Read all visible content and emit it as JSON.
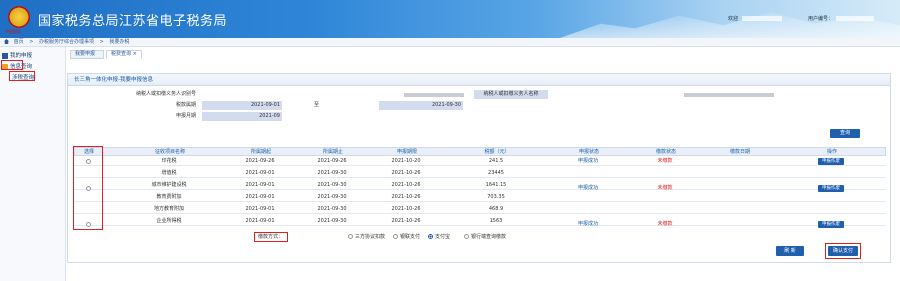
{
  "header": {
    "emblem_sub": "中国税务",
    "title": "国家税务总局江苏省电子税务局",
    "user_prefix": "欢迎",
    "user_mid": "",
    "user_label": "用户编号："
  },
  "breadcrumb": {
    "items": [
      "首页",
      ">",
      "办税服务厅综合办理事项",
      ">",
      "我要办税"
    ]
  },
  "sidebar": {
    "items": [
      {
        "label": "我的申报"
      },
      {
        "label": "信息查询"
      },
      {
        "label": "涉税查询"
      }
    ]
  },
  "tabs": [
    {
      "label": "我要申报"
    },
    {
      "label": "税费查询 ×"
    }
  ],
  "panel": {
    "title": "长三角一体化申报-我要申报信息",
    "taxpayer_id_label": "纳税人或扣缴义务人识别号",
    "taxpayer_name_label": "纳税人或扣缴义务人名称",
    "period_label": "税款属期",
    "period_start": "2021-09-01",
    "period_to": "至",
    "period_end": "2021-09-30",
    "declare_month_label": "申报月期",
    "declare_month": "2021-09",
    "query_button": "查询"
  },
  "table": {
    "headers": [
      "选择",
      "征收项目名称",
      "所属期起",
      "所属期止",
      "申报期限",
      "税额（元）",
      "申报状态",
      "缴款状态",
      "缴款日期",
      "操作"
    ],
    "rows": [
      {
        "name": "印花税",
        "start": "2021-09-26",
        "end": "2021-09-26",
        "deadline": "2021-10-20",
        "amount": "241.5"
      },
      {
        "name": "增值税",
        "start": "2021-09-01",
        "end": "2021-09-30",
        "deadline": "2021-10-26",
        "amount": "23445"
      },
      {
        "name": "城市维护建设税",
        "start": "2021-09-01",
        "end": "2021-09-30",
        "deadline": "2021-10-26",
        "amount": "1641.15"
      },
      {
        "name": "教育费附加",
        "start": "2021-09-01",
        "end": "2021-09-30",
        "deadline": "2021-10-26",
        "amount": "703.35"
      },
      {
        "name": "地方教育附加",
        "start": "2021-09-01",
        "end": "2021-09-30",
        "deadline": "2021-10-26",
        "amount": "468.9"
      },
      {
        "name": "企业所得税",
        "start": "2021-09-01",
        "end": "2021-09-30",
        "deadline": "2021-10-26",
        "amount": "1563"
      }
    ],
    "groups": [
      {
        "status": "申报成功",
        "pay_status": "未缴款",
        "action": "申报作废"
      },
      {
        "status": "申报成功",
        "pay_status": "未缴款",
        "action": "申报作废"
      },
      {
        "status": "申报成功",
        "pay_status": "未缴款",
        "action": "申报作废"
      }
    ]
  },
  "payment": {
    "label": "缴款方式：",
    "options": [
      "三方协议扣款",
      "银联支付",
      "支付宝",
      "银行端查询缴款"
    ],
    "selected_index": 2
  },
  "footer": {
    "refresh": "刷 新",
    "confirm": "确认支付"
  },
  "colors": {
    "accent": "#1f5fae",
    "alert": "#e02020"
  }
}
